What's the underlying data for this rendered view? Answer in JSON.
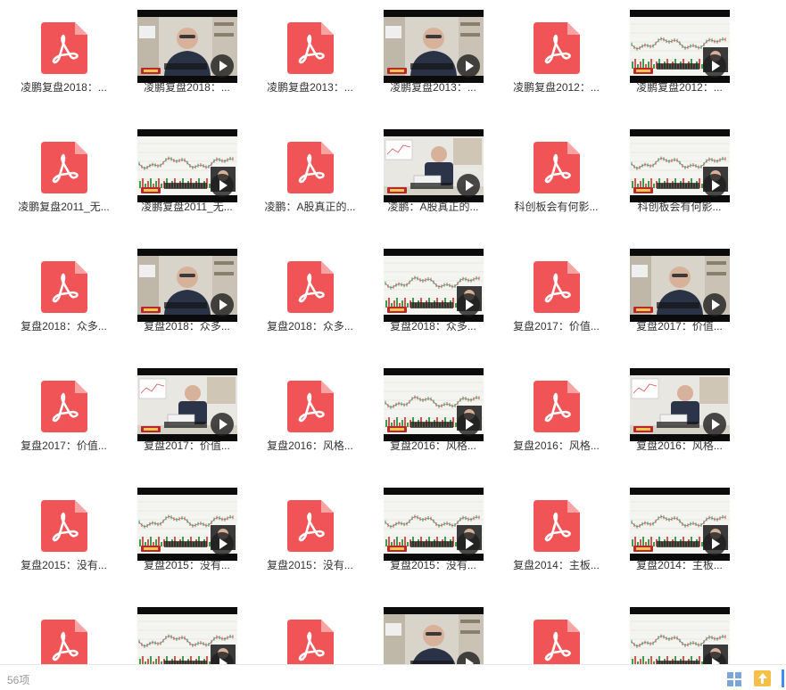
{
  "statusbar": {
    "item_count": "56项"
  },
  "icons": {
    "pdf": "pdf-file-icon",
    "video": "video-thumbnail",
    "play": "play-icon",
    "grid_view": "grid-view-icon",
    "upload": "upload-icon"
  },
  "colors": {
    "pdf_red": "#f05456",
    "accent_blue": "#3b8ef0",
    "upload_yellow": "#f5c04a"
  },
  "files": [
    {
      "type": "pdf",
      "label": "凌鹏复盘2018：..."
    },
    {
      "type": "video",
      "scene": "person",
      "label": "凌鹏复盘2018：..."
    },
    {
      "type": "pdf",
      "label": "凌鹏复盘2013：..."
    },
    {
      "type": "video",
      "scene": "person",
      "label": "凌鹏复盘2013：..."
    },
    {
      "type": "pdf",
      "label": "凌鹏复盘2012：..."
    },
    {
      "type": "video",
      "scene": "chart",
      "label": "凌鹏复盘2012：..."
    },
    {
      "type": "pdf",
      "label": "凌鹏复盘2011_无..."
    },
    {
      "type": "video",
      "scene": "chart",
      "label": "凌鹏复盘2011_无..."
    },
    {
      "type": "pdf",
      "label": "凌鹏：A股真正的..."
    },
    {
      "type": "video",
      "scene": "desk",
      "label": "凌鹏：A股真正的..."
    },
    {
      "type": "pdf",
      "label": "科创板会有何影..."
    },
    {
      "type": "video",
      "scene": "chart",
      "label": "科创板会有何影..."
    },
    {
      "type": "pdf",
      "label": "复盘2018：众多..."
    },
    {
      "type": "video",
      "scene": "person",
      "label": "复盘2018：众多..."
    },
    {
      "type": "pdf",
      "label": "复盘2018：众多..."
    },
    {
      "type": "video",
      "scene": "chart",
      "label": "复盘2018：众多..."
    },
    {
      "type": "pdf",
      "label": "复盘2017：价值..."
    },
    {
      "type": "video",
      "scene": "person",
      "label": "复盘2017：价值..."
    },
    {
      "type": "pdf",
      "label": "复盘2017：价值..."
    },
    {
      "type": "video",
      "scene": "desk",
      "label": "复盘2017：价值..."
    },
    {
      "type": "pdf",
      "label": "复盘2016：风格..."
    },
    {
      "type": "video",
      "scene": "chart",
      "label": "复盘2016：风格..."
    },
    {
      "type": "pdf",
      "label": "复盘2016：风格..."
    },
    {
      "type": "video",
      "scene": "desk",
      "label": "复盘2016：风格..."
    },
    {
      "type": "pdf",
      "label": "复盘2015：没有..."
    },
    {
      "type": "video",
      "scene": "chart",
      "label": "复盘2015：没有..."
    },
    {
      "type": "pdf",
      "label": "复盘2015：没有..."
    },
    {
      "type": "video",
      "scene": "chart",
      "label": "复盘2015：没有..."
    },
    {
      "type": "pdf",
      "label": "复盘2014：主板..."
    },
    {
      "type": "video",
      "scene": "chart",
      "label": "复盘2014：主板..."
    },
    {
      "type": "pdf",
      "label": ""
    },
    {
      "type": "video",
      "scene": "chart",
      "label": ""
    },
    {
      "type": "pdf",
      "label": ""
    },
    {
      "type": "video",
      "scene": "person",
      "label": ""
    },
    {
      "type": "pdf",
      "label": ""
    },
    {
      "type": "video",
      "scene": "chart",
      "label": ""
    }
  ]
}
